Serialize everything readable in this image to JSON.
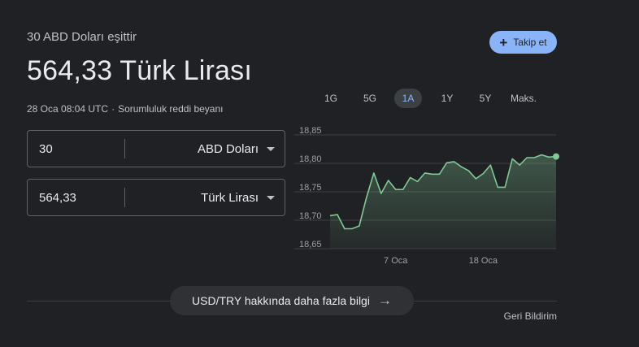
{
  "header": {
    "equals_label": "30 ABD Doları eşittir",
    "result": "564,33 Türk Lirası",
    "timestamp": "28 Oca 08:04 UTC",
    "separator": "·",
    "disclaimer": "Sorumluluk reddi beyanı",
    "follow_label": "Takip et"
  },
  "converter": {
    "from": {
      "amount": "30",
      "currency": "ABD Doları"
    },
    "to": {
      "amount": "564,33",
      "currency": "Türk Lirası"
    }
  },
  "range_tabs": [
    {
      "label": "1G",
      "active": false
    },
    {
      "label": "5G",
      "active": false
    },
    {
      "label": "1A",
      "active": true
    },
    {
      "label": "1Y",
      "active": false
    },
    {
      "label": "5Y",
      "active": false
    },
    {
      "label": "Maks.",
      "active": false
    }
  ],
  "chart_data": {
    "type": "area",
    "y_ticks": [
      "18,85",
      "18,80",
      "18,75",
      "18,70",
      "18,65"
    ],
    "ylim": [
      18.65,
      18.85
    ],
    "x_ticks": [
      {
        "label": "7 Oca",
        "index": 9
      },
      {
        "label": "18 Oca",
        "index": 21
      }
    ],
    "values": [
      18.708,
      18.71,
      18.685,
      18.685,
      18.69,
      18.74,
      18.783,
      18.747,
      18.77,
      18.754,
      18.754,
      18.775,
      18.768,
      18.783,
      18.781,
      18.781,
      18.801,
      18.803,
      18.794,
      18.787,
      18.773,
      18.782,
      18.797,
      18.758,
      18.758,
      18.808,
      18.797,
      18.81,
      18.81,
      18.815,
      18.811,
      18.812
    ],
    "line_color": "#81c995",
    "fill_color": "#81c995",
    "grid": true
  },
  "footer": {
    "more_info": "USD/TRY hakkında daha fazla bilgi",
    "arrow_icon": "→",
    "feedback": "Geri Bildirim"
  }
}
